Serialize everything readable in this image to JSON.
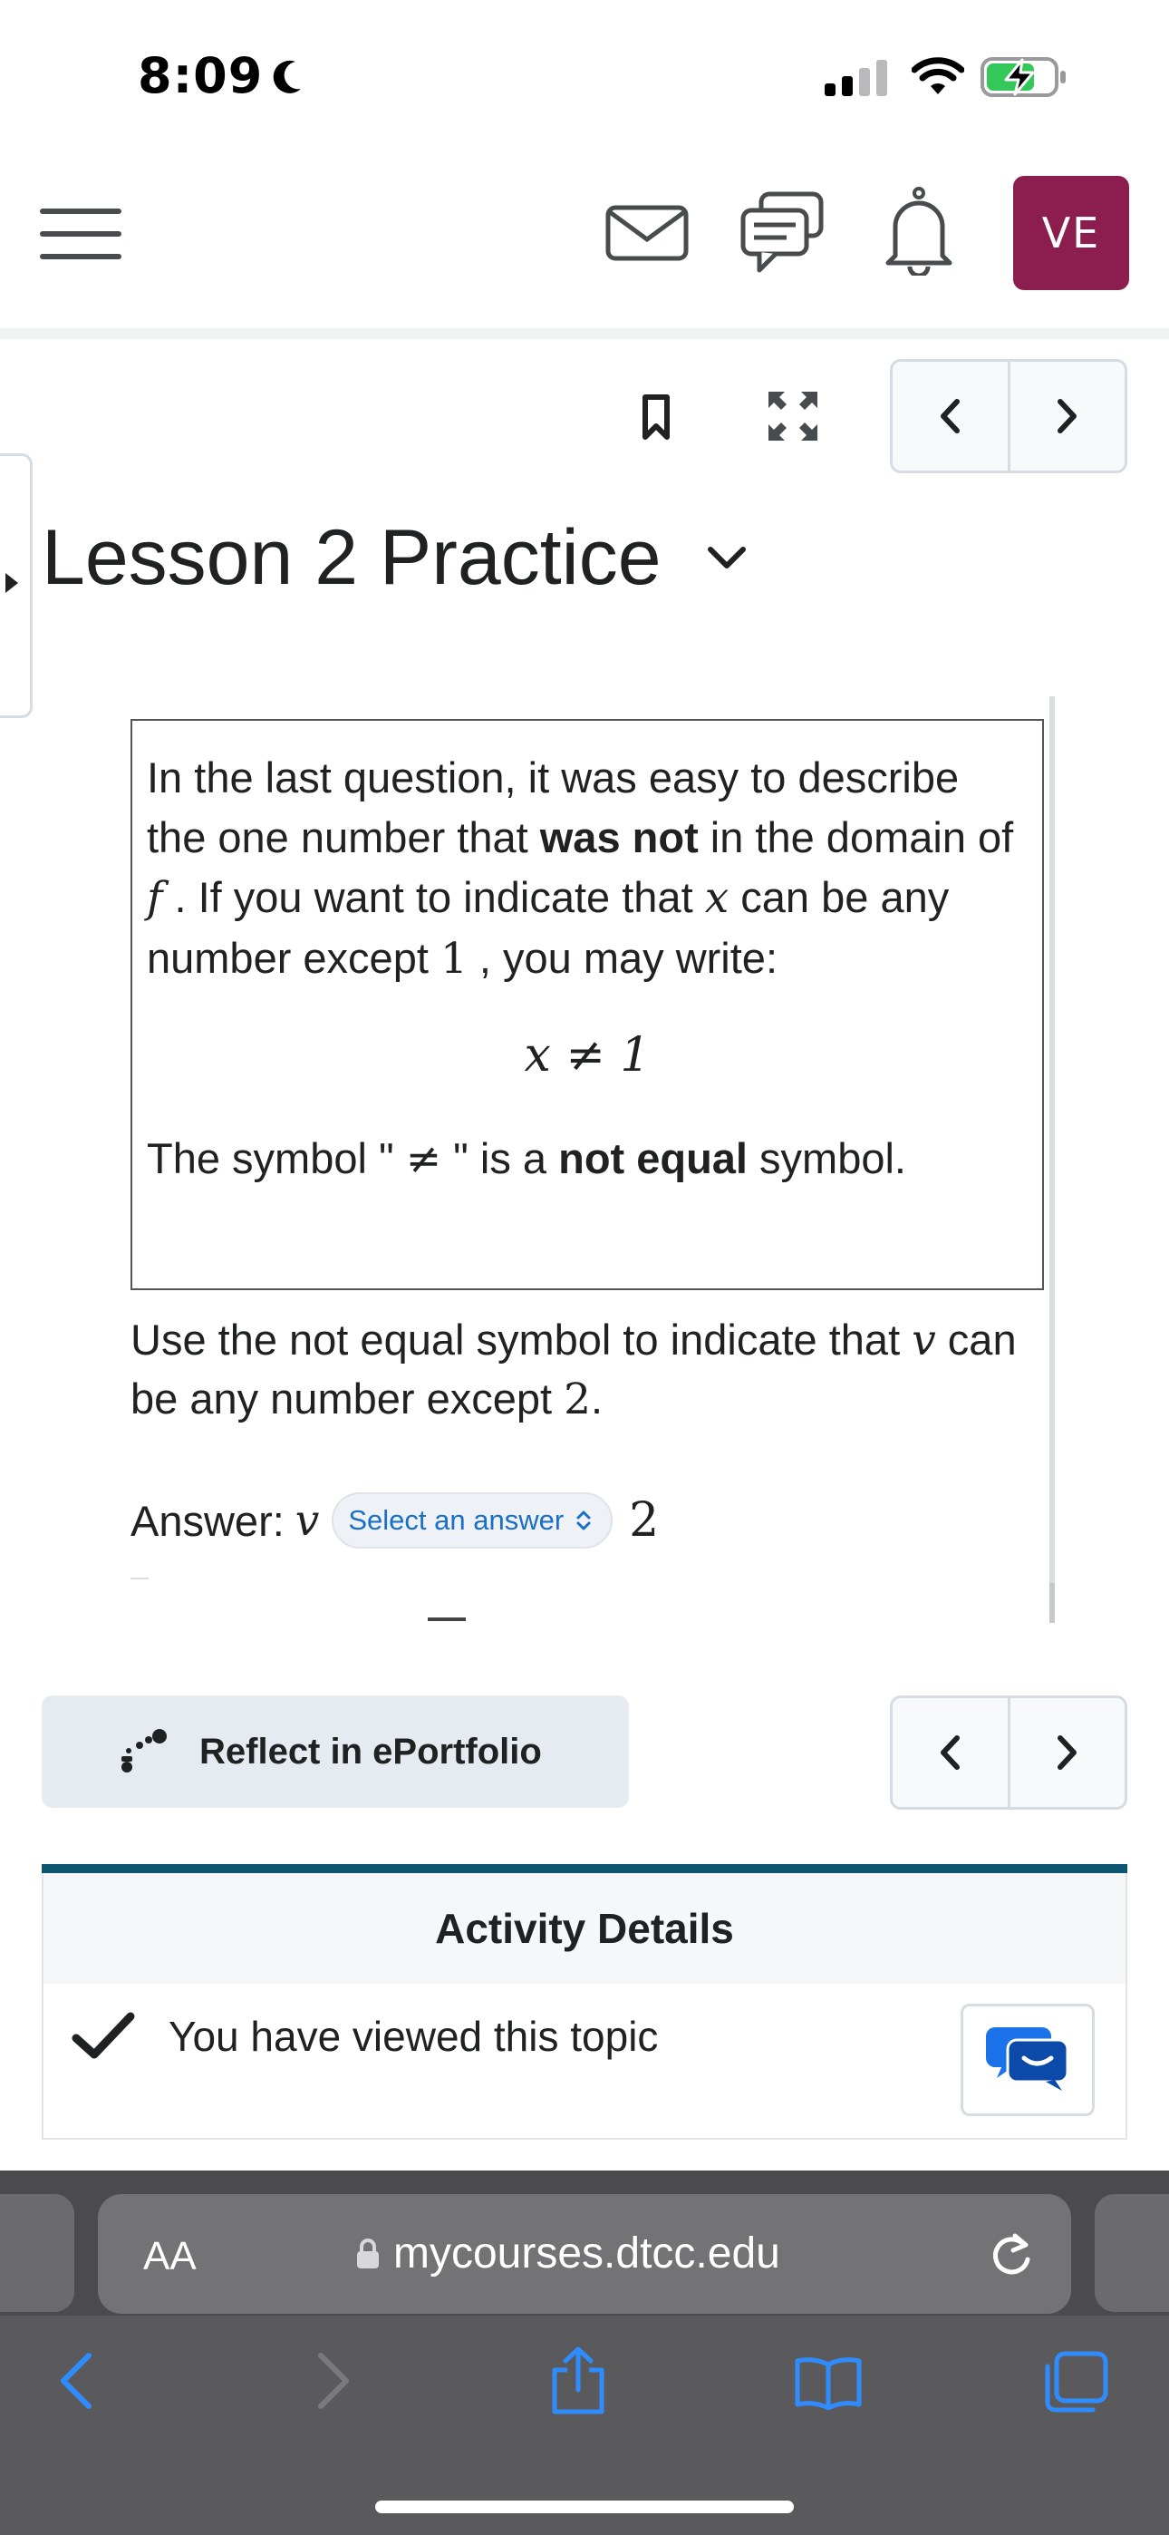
{
  "status_bar": {
    "time": "8:09"
  },
  "top_nav": {
    "avatar_initials": "VE"
  },
  "lesson": {
    "title": "Lesson 2 Practice"
  },
  "info_box": {
    "intro_1": "In the last question, it was easy to describe the one number that ",
    "intro_bold": "was not",
    "intro_2": " in the domain of ",
    "intro_var_f": "f",
    "intro_3": " . If you want to indicate that ",
    "intro_var_x": "x",
    "intro_4": " can be any number except ",
    "intro_num": "1",
    "intro_5": " , you may write:",
    "equation": "x ≠ 1",
    "symbol_prefix": "The symbol \" ",
    "symbol_glyph": "≠",
    "symbol_mid": " \"  is a ",
    "symbol_bold": "not equal",
    "symbol_suffix": " symbol."
  },
  "question": {
    "text_1": "Use the not equal symbol to indicate that ",
    "var_v": "v",
    "text_2": " can be any number except ",
    "num": "2",
    "text_3": "."
  },
  "answer": {
    "label": "Answer: ",
    "variable": "v",
    "select_placeholder": "Select an answer",
    "value": "2"
  },
  "reflect_button": {
    "label": "Reflect in ePortfolio"
  },
  "activity_details": {
    "heading": "Activity Details",
    "viewed_text": "You have viewed this topic"
  },
  "safari": {
    "text_size_label": "AA",
    "url": "mycourses.dtcc.edu"
  },
  "colors": {
    "avatar_bg": "#8b1e4e",
    "details_bar": "#0d5670",
    "select_text": "#1a6fc7",
    "reflect_bg": "#e5ebf1",
    "ios_blue": "#2f8cff"
  },
  "icons": [
    "hamburger-menu-icon",
    "mail-icon",
    "chat-bubbles-icon",
    "bell-icon",
    "bookmark-icon",
    "fullscreen-icon",
    "chevron-left-icon",
    "chevron-right-icon",
    "checkmark-icon",
    "lock-icon",
    "reload-icon",
    "share-icon",
    "bookmarks-icon",
    "tabs-icon"
  ]
}
